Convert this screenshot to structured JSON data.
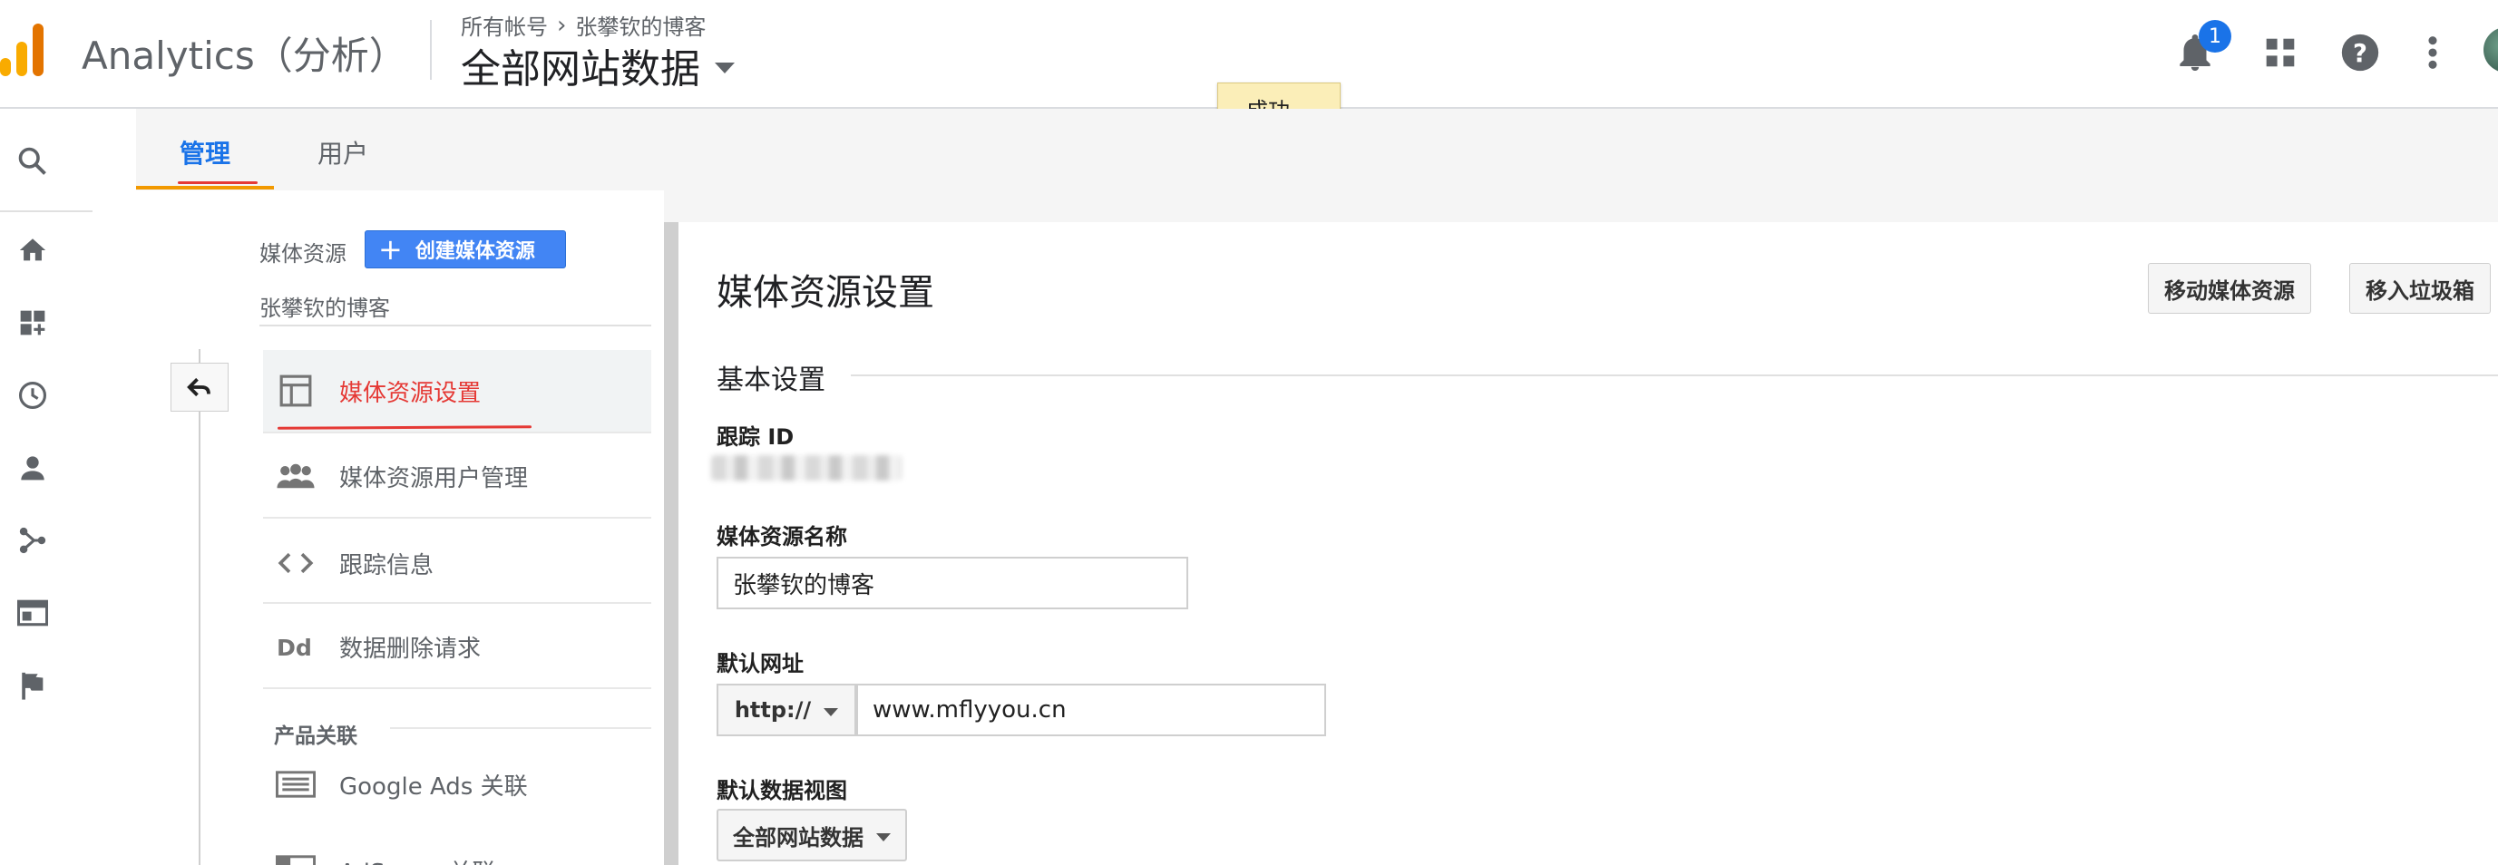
{
  "header": {
    "brand": "Analytics（分析）",
    "breadcrumb": {
      "account": "所有帐号",
      "separator": "›",
      "property": "张攀钦的博客"
    },
    "view": "全部网站数据",
    "notification_count": "1",
    "icons": [
      "bell-icon",
      "apps-grid-icon",
      "help-icon",
      "more-vert-icon",
      "avatar"
    ]
  },
  "toast": {
    "message": "成功。"
  },
  "tabs": {
    "admin": "管理",
    "user": "用户"
  },
  "left_column": {
    "label": "媒体资源",
    "create_button": "创建媒体资源",
    "create_button_symbol": "+",
    "property_name": "张攀钦的博客",
    "menu": [
      {
        "label": "媒体资源设置",
        "icon": "property-settings-icon"
      },
      {
        "label": "媒体资源用户管理",
        "icon": "people-icon"
      },
      {
        "label": "跟踪信息",
        "icon": "code-icon"
      },
      {
        "label": "数据删除请求",
        "icon": "dd-icon"
      }
    ],
    "section_product_links": "产品关联",
    "links": [
      {
        "label": "Google Ads 关联",
        "icon": "google-ads-icon"
      },
      {
        "label": "AdSense 关联",
        "icon": "adsense-icon"
      }
    ]
  },
  "settings": {
    "title": "媒体资源设置",
    "move_button": "移动媒体资源",
    "trash_button": "移入垃圾箱",
    "section_basic": "基本设置",
    "tracking_id_label": "跟踪 ID",
    "property_name_label": "媒体资源名称",
    "property_name_value": "张攀钦的博客",
    "default_url_label": "默认网址",
    "protocol": "http://",
    "default_url_value": "www.mflyyou.cn",
    "default_view_label": "默认数据视图",
    "default_view_value": "全部网站数据"
  },
  "colors": {
    "accent": "#1a73e8",
    "create_button": "#4285f4",
    "active_menu_text": "#e53935",
    "tab_underline": "#f29900",
    "toast_bg": "#fbeeb8"
  }
}
